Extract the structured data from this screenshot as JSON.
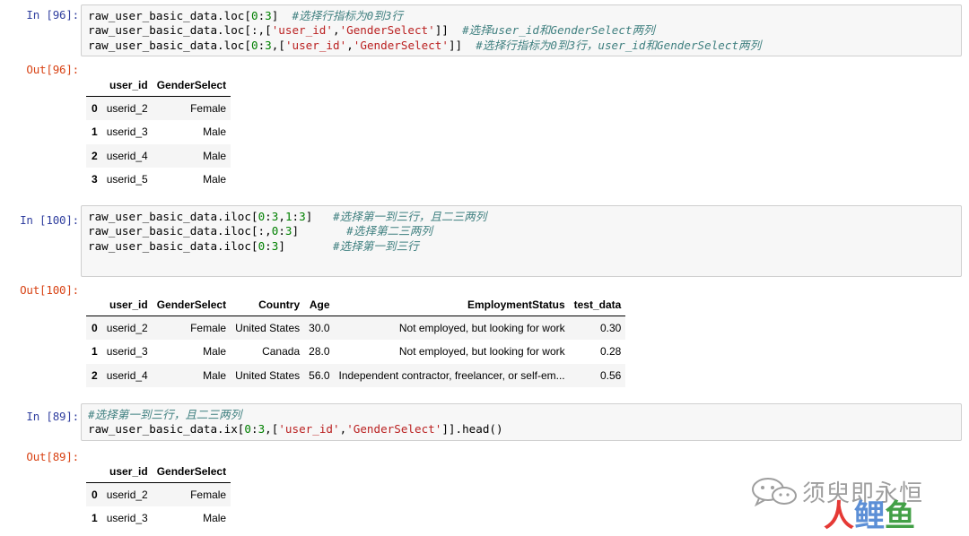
{
  "cells": [
    {
      "in_prompt": "In [96]:",
      "code": [
        [
          [
            "raw_user_basic_data.loc[",
            ""
          ],
          [
            "0",
            "n"
          ],
          [
            ":",
            ""
          ],
          [
            "3",
            "n"
          ],
          [
            "]  ",
            ""
          ],
          [
            "#选择行指标为0到3行",
            "cm"
          ]
        ],
        [
          [
            "raw_user_basic_data.loc[:,[",
            ""
          ],
          [
            "'user_id'",
            "s"
          ],
          [
            ",",
            ""
          ],
          [
            "'GenderSelect'",
            "s"
          ],
          [
            "]]  ",
            ""
          ],
          [
            "#选择user_id和GenderSelect两列",
            "cm"
          ]
        ],
        [
          [
            "raw_user_basic_data.loc[",
            ""
          ],
          [
            "0",
            "n"
          ],
          [
            ":",
            ""
          ],
          [
            "3",
            "n"
          ],
          [
            ",[",
            ""
          ],
          [
            "'user_id'",
            "s"
          ],
          [
            ",",
            ""
          ],
          [
            "'GenderSelect'",
            "s"
          ],
          [
            "]]  ",
            ""
          ],
          [
            "#选择行指标为0到3行，user_id和GenderSelect两列",
            "cm"
          ]
        ]
      ],
      "out_prompt": "Out[96]:",
      "table": {
        "columns": [
          "",
          "user_id",
          "GenderSelect"
        ],
        "rows": [
          [
            "0",
            "userid_2",
            "Female"
          ],
          [
            "1",
            "userid_3",
            "Male"
          ],
          [
            "2",
            "userid_4",
            "Male"
          ],
          [
            "3",
            "userid_5",
            "Male"
          ]
        ]
      }
    },
    {
      "in_prompt": "In [100]:",
      "code": [
        [
          [
            "raw_user_basic_data.iloc[",
            ""
          ],
          [
            "0",
            "n"
          ],
          [
            ":",
            ""
          ],
          [
            "3",
            "n"
          ],
          [
            ",",
            ""
          ],
          [
            "1",
            "n"
          ],
          [
            ":",
            ""
          ],
          [
            "3",
            "n"
          ],
          [
            "]   ",
            ""
          ],
          [
            "#选择第一到三行，且二三两列",
            "cm"
          ]
        ],
        [
          [
            "raw_user_basic_data.iloc[:,",
            ""
          ],
          [
            "0",
            "n"
          ],
          [
            ":",
            ""
          ],
          [
            "3",
            "n"
          ],
          [
            "]       ",
            ""
          ],
          [
            "#选择第二三两列",
            "cm"
          ]
        ],
        [
          [
            "raw_user_basic_data.iloc[",
            ""
          ],
          [
            "0",
            "n"
          ],
          [
            ":",
            ""
          ],
          [
            "3",
            "n"
          ],
          [
            "]       ",
            ""
          ],
          [
            "#选择第一到三行",
            "cm"
          ]
        ]
      ],
      "out_prompt": "Out[100]:",
      "table": {
        "columns": [
          "",
          "user_id",
          "GenderSelect",
          "Country",
          "Age",
          "EmploymentStatus",
          "test_data"
        ],
        "rows": [
          [
            "0",
            "userid_2",
            "Female",
            "United States",
            "30.0",
            "Not employed, but looking for work",
            "0.30"
          ],
          [
            "1",
            "userid_3",
            "Male",
            "Canada",
            "28.0",
            "Not employed, but looking for work",
            "0.28"
          ],
          [
            "2",
            "userid_4",
            "Male",
            "United States",
            "56.0",
            "Independent contractor, freelancer, or self-em...",
            "0.56"
          ]
        ]
      }
    },
    {
      "in_prompt": "In [89]:",
      "code": [
        [
          [
            "#选择第一到三行，且二三两列",
            "cm"
          ]
        ],
        [
          [
            "raw_user_basic_data.ix[",
            ""
          ],
          [
            "0",
            "n"
          ],
          [
            ":",
            ""
          ],
          [
            "3",
            "n"
          ],
          [
            ",[",
            ""
          ],
          [
            "'user_id'",
            "s"
          ],
          [
            ",",
            ""
          ],
          [
            "'GenderSelect'",
            "s"
          ],
          [
            "]].head()",
            ""
          ]
        ]
      ],
      "out_prompt": "Out[89]:",
      "table": {
        "columns": [
          "",
          "user_id",
          "GenderSelect"
        ],
        "rows": [
          [
            "0",
            "userid_2",
            "Female"
          ],
          [
            "1",
            "userid_3",
            "Male"
          ]
        ]
      }
    }
  ],
  "watermark": {
    "line1": "须臾即永恒",
    "line2": "人鲤鱼",
    "colors": {
      "gray": "#9e9e9e",
      "red": "#e53935",
      "blue": "#5c8fd6",
      "green": "#43a047"
    }
  }
}
